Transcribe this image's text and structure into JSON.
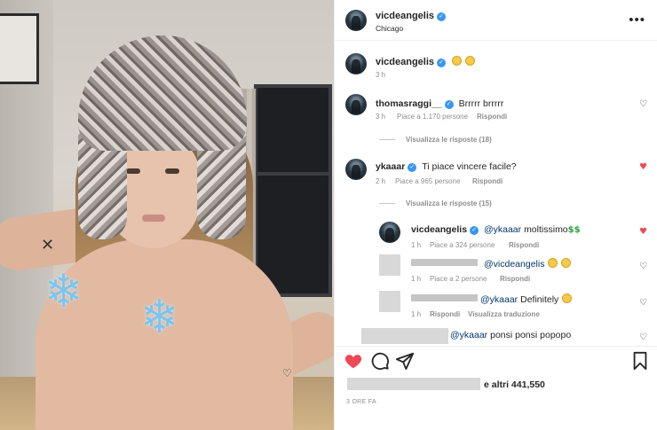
{
  "post": {
    "username": "vicdeangelis",
    "location": "Chicago",
    "menu_icon": "more-horizontal-icon"
  },
  "caption": {
    "username": "vicdeangelis",
    "emojis": [
      "crying-face",
      "crying-face"
    ],
    "time": "3 h"
  },
  "comments": [
    {
      "username": "thomasraggi__",
      "verified": true,
      "text": "Brrrrr brrrrr",
      "time": "3 h",
      "likes": "Piace a 1.170 persone",
      "reply": "Rispondi",
      "view_replies": "Visualizza le risposte (18)",
      "liked": false
    },
    {
      "username": "ykaaar",
      "verified": true,
      "text": "Ti piace vincere facile?",
      "time": "2 h",
      "likes": "Piace a 965 persone",
      "reply": "Rispondi",
      "view_replies": "Visualizza le risposte (15)",
      "liked": true
    }
  ],
  "replies": [
    {
      "username": "vicdeangelis",
      "mention": "@ykaaar",
      "text": "moltissimo",
      "money": "$$",
      "time": "1 h",
      "likes": "Piace a 324 persone",
      "reply": "Rispondi",
      "liked": true
    },
    {
      "mention": "@vicdeangelis",
      "time": "1 h",
      "likes": "Piace a 2 persone",
      "reply": "Rispondi",
      "liked": false
    },
    {
      "mention": "@ykaaar",
      "text": "Definitely",
      "time": "1 h",
      "reply": "Rispondi",
      "translate": "Visualizza traduzione",
      "liked": false
    },
    {
      "mention": "@ykaaar",
      "text": "ponsi ponsi popopo",
      "liked": false
    }
  ],
  "actions": {
    "like_icon": "heart-filled-icon",
    "comment_icon": "comment-icon",
    "share_icon": "send-icon",
    "save_icon": "bookmark-icon",
    "likes_suffix": "e altri 441,550",
    "time": "3 ORE FA"
  },
  "photo": {
    "sticker_icon": "snowflake-icon"
  },
  "colors": {
    "heart_red": "#ed4956",
    "verified_blue": "#3897f0",
    "snowflake": "#7fc4ea"
  }
}
